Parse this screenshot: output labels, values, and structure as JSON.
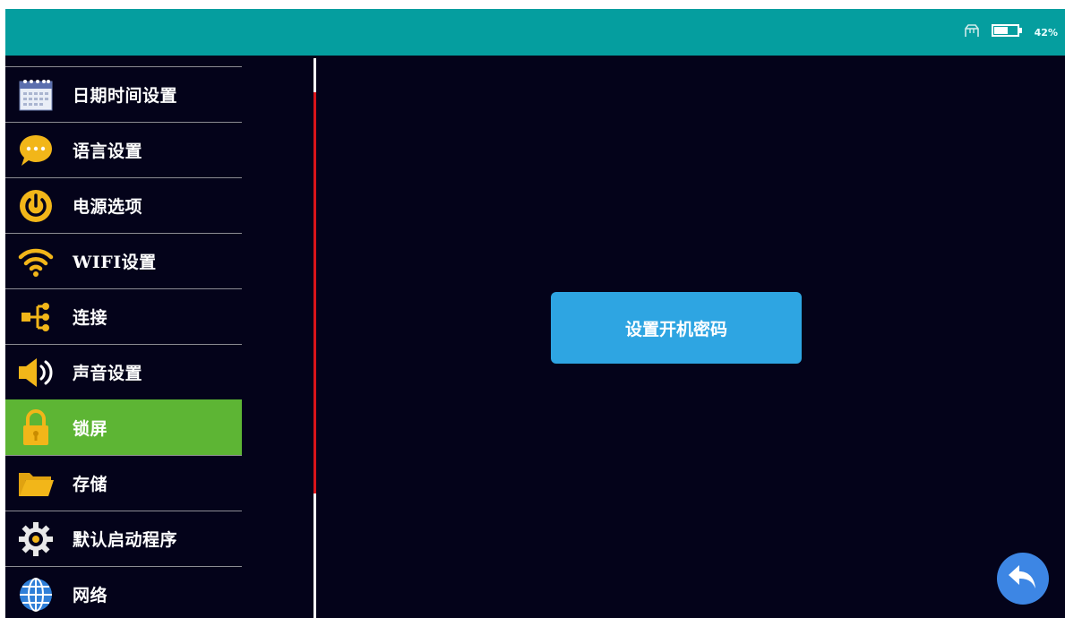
{
  "status": {
    "battery_text": "42%"
  },
  "sidebar": {
    "items": [
      {
        "label": "日期时间设置",
        "icon": "calendar-icon"
      },
      {
        "label": "语言设置",
        "icon": "chat-bubble-icon"
      },
      {
        "label": "电源选项",
        "icon": "power-icon"
      },
      {
        "label": "WIFI设置",
        "icon": "wifi-icon"
      },
      {
        "label": "连接",
        "icon": "connection-icon"
      },
      {
        "label": "声音设置",
        "icon": "speaker-icon"
      },
      {
        "label": "锁屏",
        "icon": "lock-icon",
        "active": true
      },
      {
        "label": "存储",
        "icon": "folder-icon"
      },
      {
        "label": "默认启动程序",
        "icon": "gear-icon"
      },
      {
        "label": "网络",
        "icon": "globe-icon"
      }
    ]
  },
  "main": {
    "button_label": "设置开机密码"
  },
  "colors": {
    "header": "#059e9f",
    "background": "#04031a",
    "active_item": "#5db534",
    "primary_button": "#2ea5e2",
    "scroll_thumb": "#d8141a",
    "back_button": "#3d86e4",
    "icon_accent": "#f2b619"
  }
}
